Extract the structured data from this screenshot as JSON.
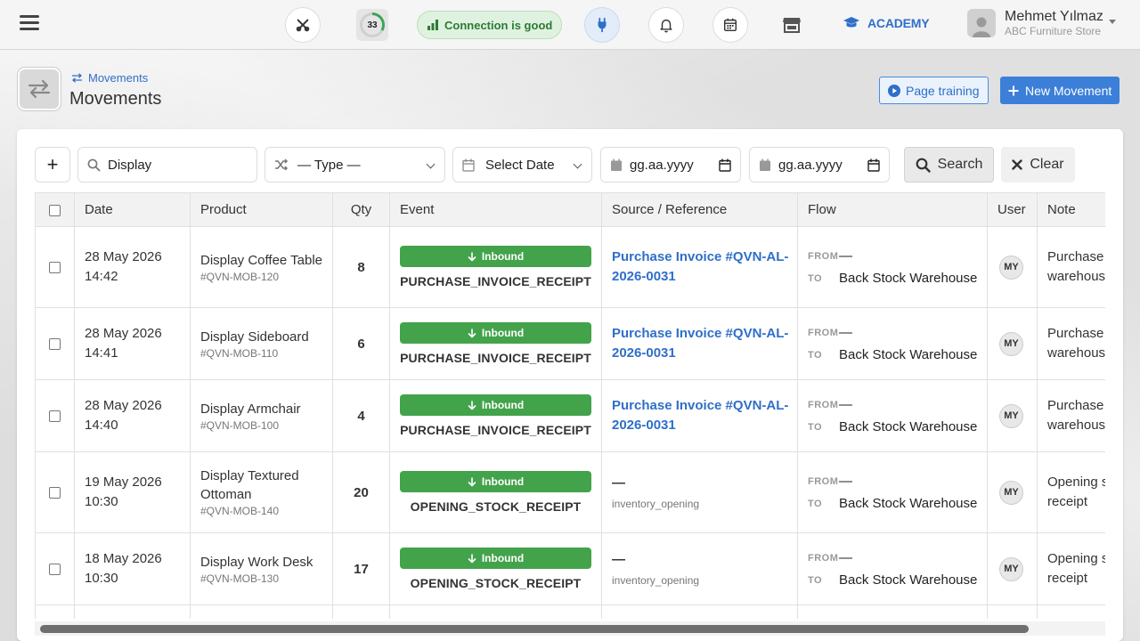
{
  "topbar": {
    "score": "33",
    "score_pct": 0.33,
    "connection_label": "Connection is good",
    "academy_label": "ACADEMY",
    "user_name": "Mehmet Yılmaz",
    "user_store": "ABC Furniture Store",
    "icons": [
      "menu-icon",
      "tools-icon",
      "plug-icon",
      "bell-icon",
      "calendar-icon",
      "store-icon",
      "graduation-cap-icon"
    ]
  },
  "header": {
    "breadcrumb": "Movements",
    "title": "Movements",
    "training_label": "Page training",
    "new_label": "New Movement"
  },
  "filters": {
    "add_label": "+",
    "search_value": "Display",
    "type_value": "— Type —",
    "date_value": "Select Date",
    "date_from_placeholder": "gg.aa.yyyy",
    "date_to_placeholder": "gg.aa.yyyy",
    "search_button": "Search",
    "clear_button": "Clear"
  },
  "table": {
    "columns": [
      "Date",
      "Product",
      "Qty",
      "Event",
      "Source / Reference",
      "Flow",
      "User",
      "Note"
    ],
    "flow_from_label": "FROM",
    "flow_to_label": "TO",
    "rows": [
      {
        "date": "28 May 2026",
        "time": "14:42",
        "product": "Display Coffee Table",
        "code": "#QVN-MOB-120",
        "qty": "8",
        "badge": "Inbound",
        "event": "PURCHASE_INVOICE_RECEIPT",
        "source": "Purchase Invoice #QVN-AL-2026-0031",
        "source_sub": "",
        "from": "—",
        "to": "Back Stock Warehouse",
        "user": "MY",
        "note1": "Purchase",
        "note2": "warehouse"
      },
      {
        "date": "28 May 2026",
        "time": "14:41",
        "product": "Display Sideboard",
        "code": "#QVN-MOB-110",
        "qty": "6",
        "badge": "Inbound",
        "event": "PURCHASE_INVOICE_RECEIPT",
        "source": "Purchase Invoice #QVN-AL-2026-0031",
        "source_sub": "",
        "from": "—",
        "to": "Back Stock Warehouse",
        "user": "MY",
        "note1": "Purchase",
        "note2": "warehouse"
      },
      {
        "date": "28 May 2026",
        "time": "14:40",
        "product": "Display Armchair",
        "code": "#QVN-MOB-100",
        "qty": "4",
        "badge": "Inbound",
        "event": "PURCHASE_INVOICE_RECEIPT",
        "source": "Purchase Invoice #QVN-AL-2026-0031",
        "source_sub": "",
        "from": "—",
        "to": "Back Stock Warehouse",
        "user": "MY",
        "note1": "Purchase",
        "note2": "warehouse"
      },
      {
        "date": "19 May 2026",
        "time": "10:30",
        "product": "Display Textured Ottoman",
        "code": "#QVN-MOB-140",
        "qty": "20",
        "badge": "Inbound",
        "event": "OPENING_STOCK_RECEIPT",
        "source": "—",
        "source_sub": "inventory_opening",
        "from": "—",
        "to": "Back Stock Warehouse",
        "user": "MY",
        "note1": "Opening s",
        "note2": "receipt"
      },
      {
        "date": "18 May 2026",
        "time": "10:30",
        "product": "Display Work Desk",
        "code": "#QVN-MOB-130",
        "qty": "17",
        "badge": "Inbound",
        "event": "OPENING_STOCK_RECEIPT",
        "source": "—",
        "source_sub": "inventory_opening",
        "from": "—",
        "to": "Back Stock Warehouse",
        "user": "MY",
        "note1": "Opening s",
        "note2": "receipt"
      }
    ]
  }
}
